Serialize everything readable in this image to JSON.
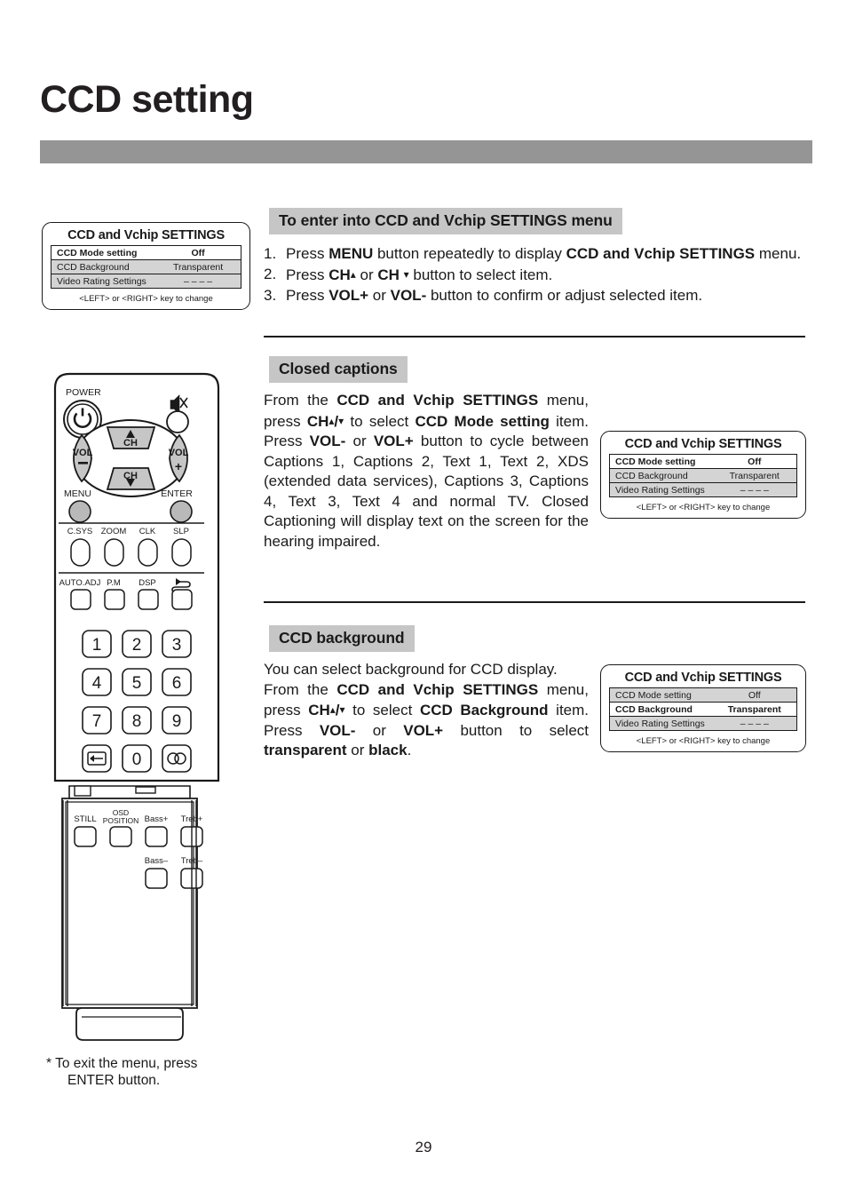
{
  "page": {
    "title": "CCD setting",
    "number": "29"
  },
  "sections": {
    "enter_menu": {
      "heading": "To enter into CCD and Vchip SETTINGS menu",
      "steps": [
        {
          "num": "1.",
          "text_parts": [
            "Press ",
            "MENU",
            " button repeatedly to display ",
            "CCD and Vchip SETTINGS",
            " menu."
          ]
        },
        {
          "num": "2.",
          "text_parts": [
            "Press ",
            "CH",
            "▴",
            " or ",
            "CH",
            "▾",
            " button to select item."
          ]
        },
        {
          "num": "3.",
          "text_parts": [
            "Press ",
            "VOL+",
            " or ",
            "VOL-",
            " button to confirm or adjust selected item."
          ]
        }
      ],
      "step1_num": "1.",
      "step2_num": "2.",
      "step3_num": "3."
    },
    "closed_captions": {
      "heading": "Closed captions",
      "body": "From the CCD and Vchip SETTINGS menu, press CH ▴ / ▾ to select CCD Mode setting item. Press VOL- or VOL+ button to cycle between Captions 1, Captions 2, Text 1, Text 2, XDS (extended data services), Captions 3, Captions 4, Text 3, Text 4 and normal TV. Closed Captioning will display text on the screen for the hearing impaired."
    },
    "ccd_background": {
      "heading": "CCD background",
      "body": "You can select background for CCD display. From the CCD and Vchip SETTINGS menu, press CH ▴ / ▾ to select CCD Background item. Press VOL- or VOL+ button to select transparent or black."
    }
  },
  "osd_menus": [
    {
      "id": "osd-1",
      "title": "CCD and Vchip SETTINGS",
      "rows": [
        {
          "label": "CCD Mode setting",
          "value": "Off",
          "selected": true
        },
        {
          "label": "CCD Background",
          "value": "Transparent",
          "selected": false
        },
        {
          "label": "Video Rating Settings",
          "value": "– – – –",
          "selected": false
        }
      ],
      "footer": "<LEFT> or <RIGHT> key to change"
    },
    {
      "id": "osd-2",
      "title": "CCD and Vchip SETTINGS",
      "rows": [
        {
          "label": "CCD Mode setting",
          "value": "Off",
          "selected": true
        },
        {
          "label": "CCD Background",
          "value": "Transparent",
          "selected": false
        },
        {
          "label": "Video Rating Settings",
          "value": "– – – –",
          "selected": false
        }
      ],
      "footer": "<LEFT> or <RIGHT> key to change"
    },
    {
      "id": "osd-3",
      "title": "CCD and Vchip SETTINGS",
      "rows": [
        {
          "label": "CCD Mode setting",
          "value": "Off",
          "selected": false
        },
        {
          "label": "CCD Background",
          "value": "Transparent",
          "selected": true
        },
        {
          "label": "Video Rating Settings",
          "value": "– – – –",
          "selected": false
        }
      ],
      "footer": "<LEFT> or <RIGHT> key to change"
    }
  ],
  "remote": {
    "power_label": "POWER",
    "power_glyph": "⏻",
    "mute_label": "mute-icon",
    "pad": {
      "ch_up": "CH",
      "ch_down": "CH",
      "vol_minus_top": "VOL",
      "vol_minus_bottom": "–",
      "vol_plus_top": "VOL",
      "vol_plus_bottom": "+"
    },
    "menu_label": "MENU",
    "enter_label": "ENTER",
    "row_csys": [
      "C.SYS",
      "ZOOM",
      "CLK",
      "SLP"
    ],
    "row_auto": [
      "AUTO.ADJ",
      "P.M",
      "DSP",
      ""
    ],
    "keypad": [
      "1",
      "2",
      "3",
      "4",
      "5",
      "6",
      "7",
      "8",
      "9",
      "recall",
      "0",
      "cc"
    ],
    "bottom_labels": {
      "still": "STILL",
      "osd_position_line1": "OSD",
      "osd_position_line2": "POSITION",
      "bass_plus": "Bass+",
      "treb_plus": "Treb+",
      "bass_minus": "Bass–",
      "treb_minus": "Treb–"
    }
  },
  "footnote": {
    "star": "*",
    "line1": "To exit the menu, press",
    "line2": "ENTER button."
  },
  "colors": {
    "title_bar": "#959595",
    "section_chip": "#c6c6c6",
    "osd_row": "#d4d4d4",
    "ink": "#1a1a1a"
  }
}
